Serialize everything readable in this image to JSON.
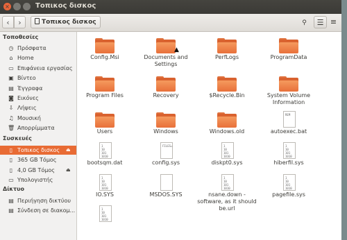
{
  "window": {
    "title": "Τοπικος δισκος"
  },
  "toolbar": {
    "back_icon": "‹",
    "forward_icon": "›",
    "path_label": "Τοπικος δισκος",
    "search_icon": "🔍",
    "view_icon": "☰",
    "menu_icon": "≡"
  },
  "sidebar": {
    "places_title": "Τοποθεσίες",
    "places": [
      {
        "label": "Πρόσφατα",
        "icon": "clock"
      },
      {
        "label": "Home",
        "icon": "home"
      },
      {
        "label": "Επιφάνεια εργασίας",
        "icon": "desktop"
      },
      {
        "label": "Βίντεο",
        "icon": "video"
      },
      {
        "label": "Έγγραφα",
        "icon": "document"
      },
      {
        "label": "Εικόνες",
        "icon": "camera"
      },
      {
        "label": "Λήψεις",
        "icon": "download"
      },
      {
        "label": "Μουσική",
        "icon": "music"
      },
      {
        "label": "Απορρίμματα",
        "icon": "trash"
      }
    ],
    "devices_title": "Συσκευές",
    "devices": [
      {
        "label": "Τοπικος δισκος",
        "icon": "drive",
        "active": true,
        "eject": true
      },
      {
        "label": "365 GB Τόμος",
        "icon": "drive"
      },
      {
        "label": "4,0 GB Τόμος",
        "icon": "usb",
        "eject": true
      },
      {
        "label": "Υπολογιστής",
        "icon": "computer"
      }
    ],
    "network_title": "Δίκτυο",
    "network": [
      {
        "label": "Περιήγηση δικτύου",
        "icon": "network"
      },
      {
        "label": "Σύνδεση σε διακομ...",
        "icon": "server"
      }
    ]
  },
  "files": [
    {
      "name": "Config.Msi",
      "type": "folder"
    },
    {
      "name": "Documents and Settings",
      "type": "folder"
    },
    {
      "name": "PerfLogs",
      "type": "folder"
    },
    {
      "name": "ProgramData",
      "type": "folder"
    },
    {
      "name": "Program Files",
      "type": "folder"
    },
    {
      "name": "Recovery",
      "type": "folder"
    },
    {
      "name": "$Recycle.Bin",
      "type": "folder"
    },
    {
      "name": "System Volume Information",
      "type": "folder"
    },
    {
      "name": "Users",
      "type": "folder"
    },
    {
      "name": "Windows",
      "type": "folder"
    },
    {
      "name": "Windows.old",
      "type": "folder"
    },
    {
      "name": "autoexec.bat",
      "type": "file",
      "preview": "REM"
    },
    {
      "name": "bootsqm.dat",
      "type": "file",
      "preview": "1\n10\n101\n1010"
    },
    {
      "name": "config.sys",
      "type": "file",
      "preview": "FILES="
    },
    {
      "name": "diskpt0.sys",
      "type": "file",
      "preview": "1\n10\n101\n1010"
    },
    {
      "name": "hiberfil.sys",
      "type": "file",
      "preview": "1\n10\n101\n1010"
    },
    {
      "name": "IO.SYS",
      "type": "file",
      "preview": "1\n10\n101\n1010"
    },
    {
      "name": "MSDOS.SYS",
      "type": "file",
      "preview": ""
    },
    {
      "name": "nsane.down - software, as it should be.url",
      "type": "file",
      "preview": "1\n10\n101\n1010"
    },
    {
      "name": "pagefile.sys",
      "type": "file",
      "preview": "1\n10\n101\n1010"
    },
    {
      "name": "",
      "type": "file",
      "preview": "1\n10\n101\n1010"
    }
  ]
}
